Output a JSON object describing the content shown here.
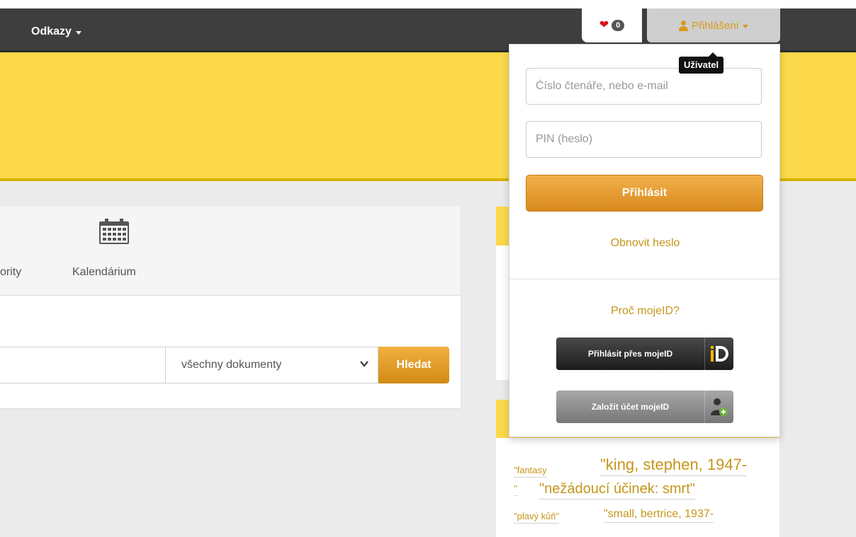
{
  "navbar": {
    "links_label": "Odkazy",
    "favorites_count": "0",
    "login_label": "Přihlášení"
  },
  "tabs": {
    "authorities_fragment": "ority",
    "calendar_label": "Kalendárium"
  },
  "search": {
    "query_placeholder": "",
    "document_type": "všechny dokumenty",
    "button_label": "Hledat"
  },
  "login_dropdown": {
    "tooltip": "Uživatel",
    "reader_placeholder": "Číslo čtenáře, nebo e-mail",
    "pin_placeholder": "PIN (heslo)",
    "login_button": "Přihlásit",
    "reset_password": "Obnovit heslo",
    "why_mojeid": "Proč mojeID?",
    "login_mojeid": "Přihlásit přes mojeID",
    "create_mojeid": "Založit účet mojeID"
  },
  "tag_cloud": [
    {
      "text": "\"fantasy",
      "size": "small"
    },
    {
      "text": "\"king, stephen, 1947-",
      "size": "large"
    },
    {
      "text": "\"",
      "size": "small"
    },
    {
      "text": "\"nežádoucí účinek: smrt\"",
      "size": "large"
    },
    {
      "text": "\"plavý kůň\"",
      "size": "small"
    },
    {
      "text": "\"small, bertrice, 1937-",
      "size": "medium"
    }
  ],
  "colors": {
    "navbar": "#3e3e3e",
    "accent_yellow": "#fbd94a",
    "accent_orange": "#d8891d",
    "link_gold": "#c5961c"
  }
}
